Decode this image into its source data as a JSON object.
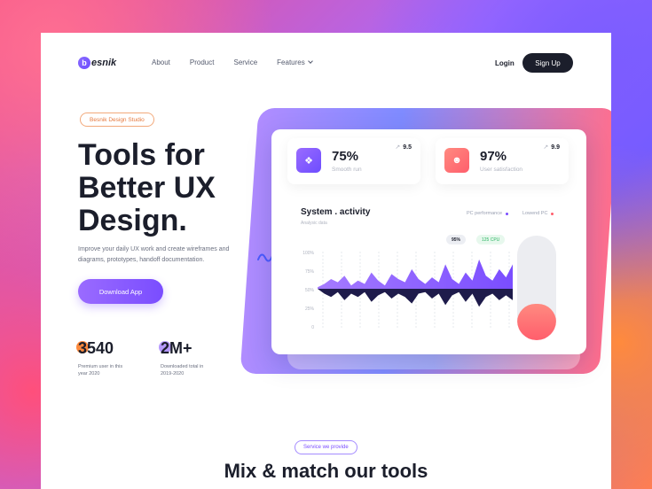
{
  "brand": {
    "mark": "b",
    "name": "esnik"
  },
  "nav": {
    "items": [
      "About",
      "Product",
      "Service",
      "Features"
    ],
    "login": "Login",
    "signup": "Sign Up"
  },
  "hero": {
    "badge": "Besnik Design Studio",
    "title": "Tools for Better UX Design.",
    "description": "Improve your daily UX work and create wireframes and diagrams, prototypes, handoff documentation.",
    "cta": "Download App",
    "stats": [
      {
        "value": "3540",
        "label": "Premium user in this year 2020"
      },
      {
        "value": "2M+",
        "label": "Downloaded total in 2019-2020"
      }
    ]
  },
  "dashboard": {
    "cards": [
      {
        "value": "75%",
        "label": "Smooth run",
        "rating": "9.5",
        "icon": "handshake-icon"
      },
      {
        "value": "97%",
        "label": "User satisfaction",
        "rating": "9.9",
        "icon": "user-badge-icon"
      }
    ],
    "activity": {
      "title": "System . activity",
      "subtitle": "Analysic data",
      "legend": [
        "PC performance",
        "Lowend PC"
      ],
      "pills": [
        "95%",
        "125 CPU"
      ],
      "y_ticks": [
        "100%",
        "75%",
        "50%",
        "25%",
        "0"
      ]
    },
    "gauge_level": 0.35
  },
  "chart_data": {
    "type": "area",
    "title": "System . activity",
    "ylim": [
      0,
      100
    ],
    "y_ticks": [
      "100%",
      "75%",
      "50%",
      "25%",
      "0"
    ],
    "series": [
      {
        "name": "PC performance",
        "values": [
          52,
          56,
          62,
          58,
          66,
          54,
          60,
          56,
          70,
          60,
          54,
          68,
          62,
          58,
          74,
          62,
          56,
          64,
          58,
          80,
          62,
          56,
          70,
          60,
          86,
          66,
          60,
          74,
          64,
          80
        ]
      },
      {
        "name": "Lowend PC",
        "values": [
          50,
          44,
          40,
          46,
          36,
          44,
          40,
          46,
          34,
          42,
          46,
          38,
          44,
          40,
          32,
          44,
          46,
          38,
          44,
          30,
          42,
          46,
          34,
          44,
          28,
          40,
          44,
          36,
          42,
          36
        ]
      }
    ],
    "colors": {
      "series1": "#8a5cff",
      "series2": "#1e1b4b"
    }
  },
  "section": {
    "badge": "Service we provide",
    "title": "Mix & match our tools"
  }
}
